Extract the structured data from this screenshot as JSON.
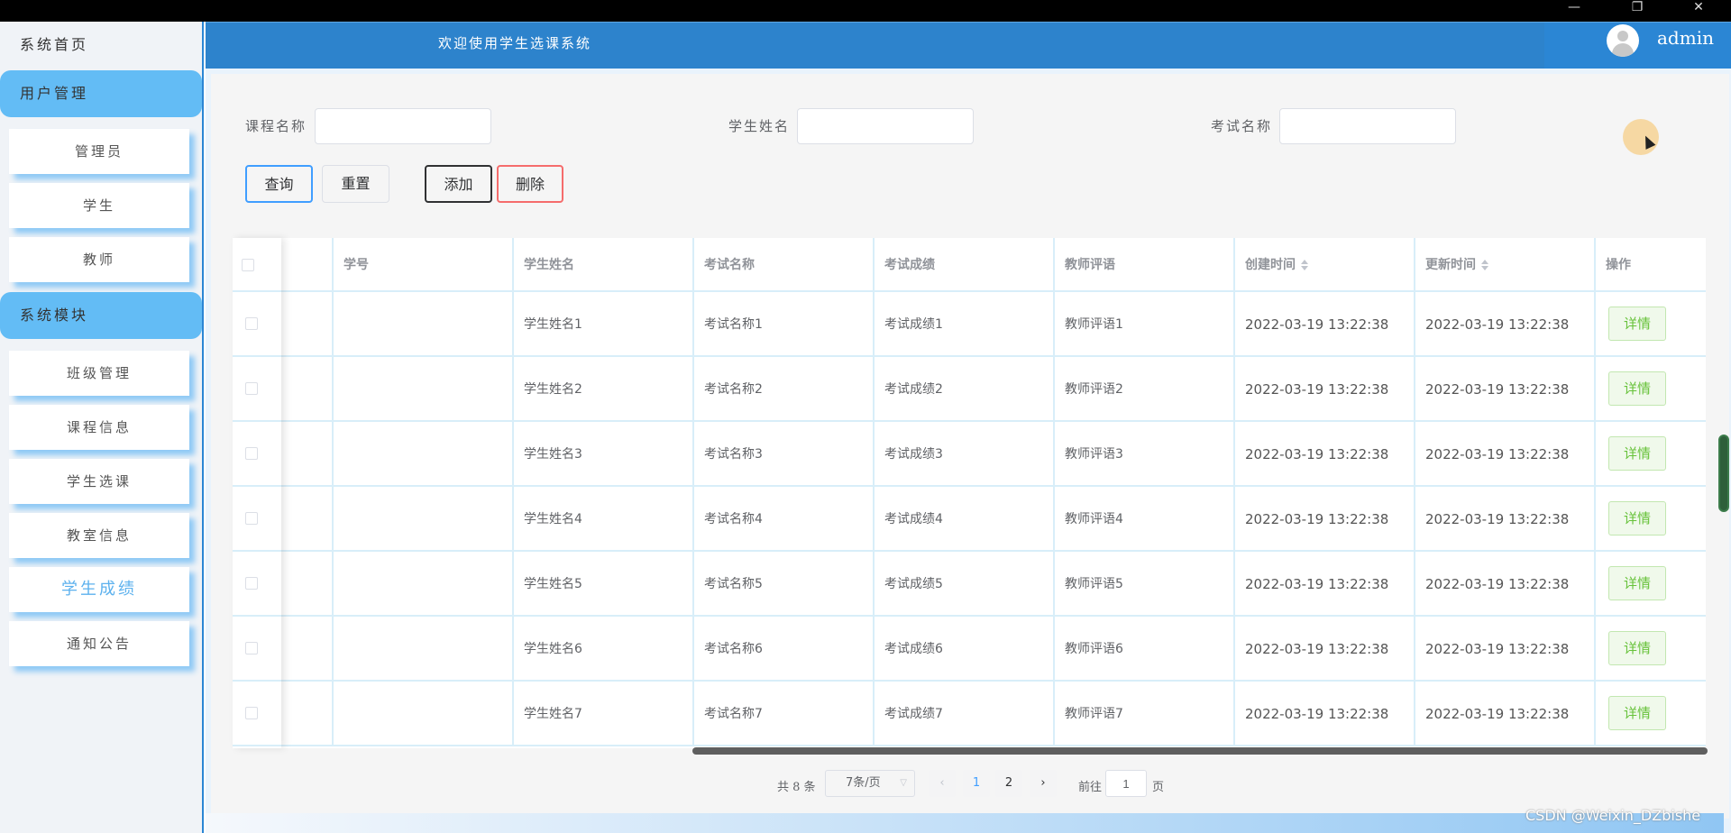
{
  "window": {
    "minimize_glyph": "—",
    "maximize_glyph": "❐",
    "close_glyph": "✕"
  },
  "sidebar": {
    "home": "系统首页",
    "groups": [
      {
        "label": "用户管理",
        "items": [
          "管理员",
          "学生",
          "教师"
        ]
      },
      {
        "label": "系统模块",
        "items": [
          "班级管理",
          "课程信息",
          "学生选课",
          "教室信息",
          "学生成绩",
          "通知公告"
        ]
      }
    ],
    "active_item": "学生成绩"
  },
  "header": {
    "title": "欢迎使用学生选课系统",
    "username": "admin"
  },
  "search": {
    "course_label": "课程名称",
    "course_value": "",
    "student_label": "学生姓名",
    "student_value": "",
    "exam_label": "考试名称",
    "exam_value": ""
  },
  "buttons": {
    "query": "查询",
    "reset": "重置",
    "add": "添加",
    "delete": "删除"
  },
  "table": {
    "columns": [
      "学号",
      "学生姓名",
      "考试名称",
      "考试成绩",
      "教师评语",
      "创建时间",
      "更新时间",
      "操作"
    ],
    "action_label": "详情",
    "rows": [
      {
        "student_no": "",
        "student_name": "学生姓名1",
        "exam_name": "考试名称1",
        "score": "考试成绩1",
        "comment": "教师评语1",
        "created": "2022-03-19 13:22:38",
        "updated": "2022-03-19 13:22:38"
      },
      {
        "student_no": "",
        "student_name": "学生姓名2",
        "exam_name": "考试名称2",
        "score": "考试成绩2",
        "comment": "教师评语2",
        "created": "2022-03-19 13:22:38",
        "updated": "2022-03-19 13:22:38"
      },
      {
        "student_no": "",
        "student_name": "学生姓名3",
        "exam_name": "考试名称3",
        "score": "考试成绩3",
        "comment": "教师评语3",
        "created": "2022-03-19 13:22:38",
        "updated": "2022-03-19 13:22:38"
      },
      {
        "student_no": "",
        "student_name": "学生姓名4",
        "exam_name": "考试名称4",
        "score": "考试成绩4",
        "comment": "教师评语4",
        "created": "2022-03-19 13:22:38",
        "updated": "2022-03-19 13:22:38"
      },
      {
        "student_no": "",
        "student_name": "学生姓名5",
        "exam_name": "考试名称5",
        "score": "考试成绩5",
        "comment": "教师评语5",
        "created": "2022-03-19 13:22:38",
        "updated": "2022-03-19 13:22:38"
      },
      {
        "student_no": "",
        "student_name": "学生姓名6",
        "exam_name": "考试名称6",
        "score": "考试成绩6",
        "comment": "教师评语6",
        "created": "2022-03-19 13:22:38",
        "updated": "2022-03-19 13:22:38"
      },
      {
        "student_no": "",
        "student_name": "学生姓名7",
        "exam_name": "考试名称7",
        "score": "考试成绩7",
        "comment": "教师评语7",
        "created": "2022-03-19 13:22:38",
        "updated": "2022-03-19 13:22:38"
      }
    ]
  },
  "pagination": {
    "total": "共 8 条",
    "page_size": "7条/页",
    "prev": "‹",
    "next": "›",
    "pages": [
      "1",
      "2"
    ],
    "current_page": "1",
    "goto_label": "前往",
    "goto_value": "1",
    "page_suffix": "页"
  },
  "watermark": "CSDN @Weixin_DZbishe",
  "colors": {
    "header": "#2d83cc",
    "sidebar_group": "#63bcf5",
    "active_item": "#5cb1ee",
    "detail_button": "#67c23a",
    "primary": "#409eff",
    "danger": "#f56c6c"
  }
}
